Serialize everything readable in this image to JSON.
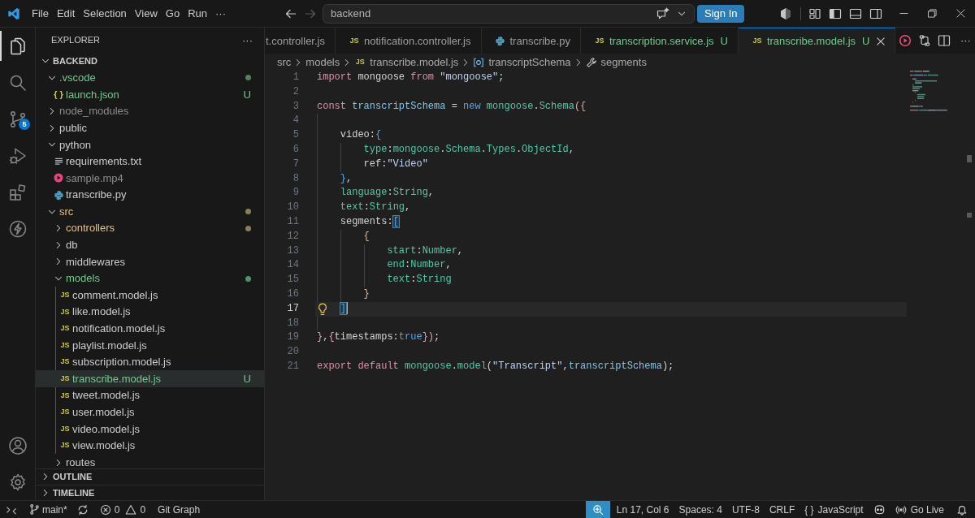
{
  "title_bar": {
    "menu": [
      "File",
      "Edit",
      "Selection",
      "View",
      "Go",
      "Run",
      "···"
    ],
    "navigation": {
      "back": {
        "disabled": false
      },
      "forward": {
        "disabled": true
      }
    },
    "search": {
      "value": "backend"
    },
    "sign_in": "Sign In"
  },
  "activity_bar": {
    "top": [
      {
        "kind": "explorer",
        "selected": true
      },
      {
        "kind": "search",
        "selected": false
      },
      {
        "kind": "source_control",
        "selected": false,
        "badge": "5"
      },
      {
        "kind": "run_debug",
        "selected": false
      },
      {
        "kind": "extensions",
        "selected": false
      },
      {
        "kind": "lightning",
        "selected": false
      }
    ],
    "bottom": [
      {
        "kind": "account"
      },
      {
        "kind": "settings"
      }
    ]
  },
  "sidebar": {
    "title": "EXPLORER",
    "more": "···",
    "tree": {
      "label": "BACKEND",
      "expanded": true,
      "children": [
        {
          "label": ".vscode",
          "expanded": true,
          "color": "#73c991",
          "dot": {
            "color": "#557f63"
          },
          "selected": false,
          "children": [
            {
              "label": "launch.json",
              "kind": "json",
              "glyph": "{ }",
              "color": "#73c991",
              "badge": "U",
              "selected": false
            }
          ]
        },
        {
          "label": "node_modules",
          "expanded": false,
          "color": "#8c8c8c",
          "selected": false
        },
        {
          "label": "public",
          "expanded": false,
          "color": "#cccccc",
          "selected": false
        },
        {
          "label": "python",
          "expanded": true,
          "color": "#cccccc",
          "selected": false,
          "children": [
            {
              "label": "requirements.txt",
              "kind": "text",
              "color": "#cccccc",
              "selected": false
            },
            {
              "label": "sample.mp4",
              "kind": "video",
              "color": "#8c8c8c",
              "selected": false
            },
            {
              "label": "transcribe.py",
              "kind": "python",
              "color": "#cccccc",
              "selected": false
            }
          ]
        },
        {
          "label": "src",
          "expanded": true,
          "color": "#e2c08d",
          "dot": {
            "color": "#8b7d5c"
          },
          "selected": false,
          "children": [
            {
              "label": "controllers",
              "expanded": false,
              "color": "#e2c08d",
              "dot": {
                "color": "#8b7d5c"
              },
              "selected": false
            },
            {
              "label": "db",
              "expanded": false,
              "color": "#cccccc",
              "selected": false
            },
            {
              "label": "middlewares",
              "expanded": false,
              "color": "#cccccc",
              "selected": false
            },
            {
              "label": "models",
              "expanded": true,
              "color": "#73c991",
              "dot": {
                "color": "#4f9466"
              },
              "selected": false,
              "children": [
                {
                  "label": "comment.model.js",
                  "kind": "js",
                  "glyph": "JS",
                  "color": "#cccccc",
                  "selected": false
                },
                {
                  "label": "like.model.js",
                  "kind": "js",
                  "glyph": "JS",
                  "color": "#cccccc",
                  "selected": false
                },
                {
                  "label": "notification.model.js",
                  "kind": "js",
                  "glyph": "JS",
                  "color": "#cccccc",
                  "selected": false
                },
                {
                  "label": "playlist.model.js",
                  "kind": "js",
                  "glyph": "JS",
                  "color": "#cccccc",
                  "selected": false
                },
                {
                  "label": "subscription.model.js",
                  "kind": "js",
                  "glyph": "JS",
                  "color": "#cccccc",
                  "selected": false
                },
                {
                  "label": "transcribe.model.js",
                  "kind": "js",
                  "glyph": "JS",
                  "color": "#73c991",
                  "badge": "U",
                  "selected": true
                },
                {
                  "label": "tweet.model.js",
                  "kind": "js",
                  "glyph": "JS",
                  "color": "#cccccc",
                  "selected": false
                },
                {
                  "label": "user.model.js",
                  "kind": "js",
                  "glyph": "JS",
                  "color": "#cccccc",
                  "selected": false
                },
                {
                  "label": "video.model.js",
                  "kind": "js",
                  "glyph": "JS",
                  "color": "#cccccc",
                  "selected": false
                },
                {
                  "label": "view.model.js",
                  "kind": "js",
                  "glyph": "JS",
                  "color": "#cccccc",
                  "selected": false
                }
              ]
            },
            {
              "label": "routes",
              "expanded": false,
              "color": "#cccccc",
              "selected": false
            }
          ]
        }
      ]
    },
    "sections": [
      {
        "label": "OUTLINE",
        "expanded": false
      },
      {
        "label": "TIMELINE",
        "expanded": false
      }
    ]
  },
  "editor": {
    "tabs": [
      {
        "label": "t.controller.js",
        "color": "#9d9d9d",
        "selected": false
      },
      {
        "label": "notification.controller.js",
        "kind": "js",
        "glyph": "JS",
        "color": "#9d9d9d",
        "selected": false
      },
      {
        "label": "transcribe.py",
        "kind": "python",
        "color": "#9d9d9d",
        "selected": false
      },
      {
        "label": "transcription.service.js",
        "kind": "js",
        "glyph": "JS",
        "color": "#73c991",
        "badge": "U",
        "selected": false
      },
      {
        "label": "transcribe.model.js",
        "kind": "js",
        "glyph": "JS",
        "color": "#73c991",
        "badge": "U",
        "selected": true
      }
    ],
    "more": "···",
    "breadcrumbs": [
      {
        "label": "src"
      },
      {
        "label": "models"
      },
      {
        "label": "transcribe.model.js",
        "kind": "js",
        "glyph": "JS"
      },
      {
        "label": "transcriptSchema",
        "kind": "variable"
      },
      {
        "label": "segments",
        "kind": "property"
      }
    ],
    "lines": [
      {
        "number": "1",
        "current": false,
        "tokens": [
          {
            "text": "import",
            "kind": "keyword"
          },
          {
            "text": " mongoose ",
            "kind": "plain"
          },
          {
            "text": "from",
            "kind": "keyword"
          },
          {
            "text": " \"mongoose\"",
            "kind": "string"
          },
          {
            "text": ";",
            "kind": "plain"
          }
        ]
      },
      {
        "number": "2",
        "current": false
      },
      {
        "number": "3",
        "current": false,
        "tokens": [
          {
            "text": "const",
            "kind": "keyword"
          },
          {
            "text": " transcriptSchema",
            "kind": "variable"
          },
          {
            "text": " = ",
            "kind": "plain"
          },
          {
            "text": "new",
            "kind": "constant"
          },
          {
            "text": " mongoose",
            "kind": "type"
          },
          {
            "text": ".",
            "kind": "plain"
          },
          {
            "text": "Schema",
            "kind": "type"
          },
          {
            "text": "({",
            "kind": "bracket_1"
          }
        ]
      },
      {
        "number": "4",
        "current": false
      },
      {
        "number": "5",
        "current": false,
        "tokens": [
          {
            "text": "    video:",
            "kind": "plain"
          },
          {
            "text": "{",
            "kind": "bracket_2"
          }
        ]
      },
      {
        "number": "6",
        "current": false,
        "tokens": [
          {
            "text": "        type",
            "kind": "property"
          },
          {
            "text": ":",
            "kind": "plain"
          },
          {
            "text": "mongoose",
            "kind": "type"
          },
          {
            "text": ".",
            "kind": "plain"
          },
          {
            "text": "Schema",
            "kind": "type"
          },
          {
            "text": ".",
            "kind": "plain"
          },
          {
            "text": "Types",
            "kind": "type"
          },
          {
            "text": ".",
            "kind": "plain"
          },
          {
            "text": "ObjectId",
            "kind": "type"
          },
          {
            "text": ",",
            "kind": "plain"
          }
        ]
      },
      {
        "number": "7",
        "current": false,
        "tokens": [
          {
            "text": "        ref:",
            "kind": "plain"
          },
          {
            "text": "\"Video\"",
            "kind": "string"
          }
        ]
      },
      {
        "number": "8",
        "current": false,
        "tokens": [
          {
            "text": "    }",
            "kind": "bracket_2"
          },
          {
            "text": ",",
            "kind": "plain"
          }
        ]
      },
      {
        "number": "9",
        "current": false,
        "tokens": [
          {
            "text": "    language",
            "kind": "property"
          },
          {
            "text": ":",
            "kind": "plain"
          },
          {
            "text": "String",
            "kind": "type"
          },
          {
            "text": ",",
            "kind": "plain"
          }
        ]
      },
      {
        "number": "10",
        "current": false,
        "tokens": [
          {
            "text": "    text",
            "kind": "property"
          },
          {
            "text": ":",
            "kind": "plain"
          },
          {
            "text": "String",
            "kind": "type"
          },
          {
            "text": ",",
            "kind": "plain"
          }
        ]
      },
      {
        "number": "11",
        "current": false,
        "tokens": [
          {
            "text": "    segments:",
            "kind": "plain"
          },
          {
            "text": "[",
            "kind": "bracket_match"
          }
        ]
      },
      {
        "number": "12",
        "current": false,
        "tokens": [
          {
            "text": "        {",
            "kind": "bracket_3"
          }
        ]
      },
      {
        "number": "13",
        "current": false,
        "tokens": [
          {
            "text": "            start",
            "kind": "property"
          },
          {
            "text": ":",
            "kind": "plain"
          },
          {
            "text": "Number",
            "kind": "type"
          },
          {
            "text": ",",
            "kind": "plain"
          }
        ]
      },
      {
        "number": "14",
        "current": false,
        "tokens": [
          {
            "text": "            end",
            "kind": "property"
          },
          {
            "text": ":",
            "kind": "plain"
          },
          {
            "text": "Number",
            "kind": "type"
          },
          {
            "text": ",",
            "kind": "plain"
          }
        ]
      },
      {
        "number": "15",
        "current": false,
        "tokens": [
          {
            "text": "            text",
            "kind": "property"
          },
          {
            "text": ":",
            "kind": "plain"
          },
          {
            "text": "String",
            "kind": "type"
          }
        ]
      },
      {
        "number": "16",
        "current": false,
        "tokens": [
          {
            "text": "        }",
            "kind": "bracket_3"
          }
        ]
      },
      {
        "number": "17",
        "current": true,
        "tokens": [
          {
            "text": "    ]",
            "kind": "bracket_match"
          }
        ]
      },
      {
        "number": "18",
        "current": false
      },
      {
        "number": "19",
        "current": false,
        "tokens": [
          {
            "text": "}",
            "kind": "bracket_1"
          },
          {
            "text": ",",
            "kind": "plain"
          },
          {
            "text": "{",
            "kind": "bracket_1"
          },
          {
            "text": "timestamps:",
            "kind": "plain"
          },
          {
            "text": "true",
            "kind": "constant"
          },
          {
            "text": "})",
            "kind": "bracket_1"
          },
          {
            "text": ";",
            "kind": "plain"
          }
        ]
      },
      {
        "number": "20",
        "current": false
      },
      {
        "number": "21",
        "current": false,
        "tokens": [
          {
            "text": "export default",
            "kind": "keyword"
          },
          {
            "text": " mongoose",
            "kind": "type"
          },
          {
            "text": ".",
            "kind": "plain"
          },
          {
            "text": "model",
            "kind": "type"
          },
          {
            "text": "(",
            "kind": "plain"
          },
          {
            "text": "\"Transcript\"",
            "kind": "string"
          },
          {
            "text": ",",
            "kind": "plain"
          },
          {
            "text": "transcriptSchema",
            "kind": "variable"
          },
          {
            "text": ");",
            "kind": "plain"
          }
        ]
      }
    ]
  },
  "status_bar": {
    "left": [
      {
        "kind": "remote"
      },
      {
        "kind": "branch",
        "text": "main*"
      },
      {
        "kind": "sync"
      },
      {
        "kind": "problems",
        "errors": "0",
        "warnings": "0"
      },
      {
        "kind": "plain",
        "text": "Git Graph"
      }
    ],
    "right": [
      {
        "kind": "zoom"
      },
      {
        "kind": "plain",
        "text": "Ln 17, Col 6"
      },
      {
        "kind": "plain",
        "text": "Spaces: 4"
      },
      {
        "kind": "plain",
        "text": "UTF-8"
      },
      {
        "kind": "plain",
        "text": "CRLF"
      },
      {
        "kind": "language",
        "glyph": "{ }",
        "text": "JavaScript"
      },
      {
        "kind": "copilot"
      },
      {
        "kind": "live",
        "text": "Go Live"
      },
      {
        "kind": "notifications"
      }
    ]
  }
}
